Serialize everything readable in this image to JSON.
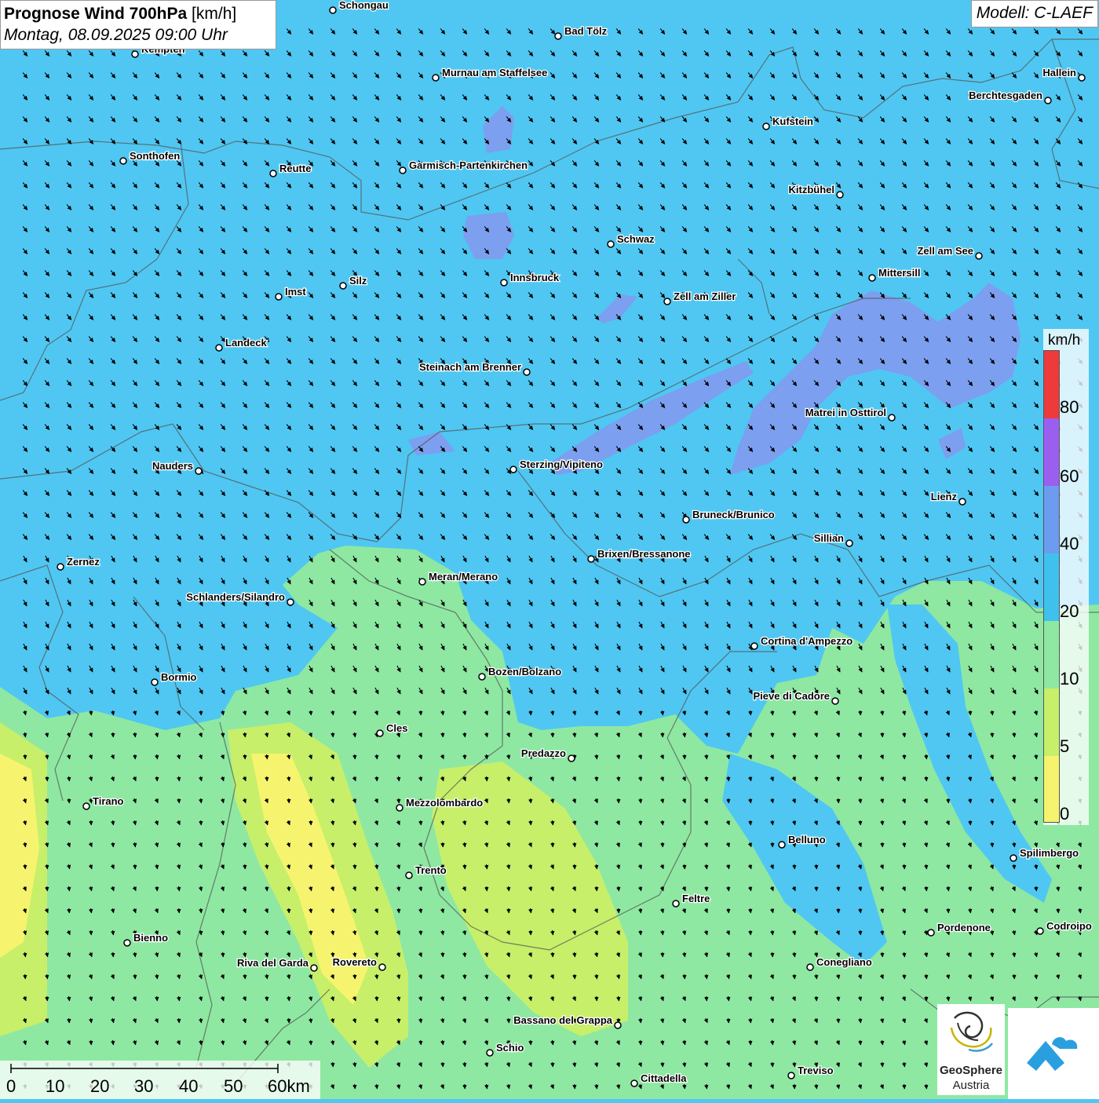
{
  "header": {
    "title_bold": "Prognose Wind 700hPa",
    "title_unit": "[km/h]",
    "subtitle": "Montag, 08.09.2025 09:00 Uhr",
    "model": "Modell: C-LAEF"
  },
  "legend": {
    "unit": "km/h",
    "ticks": [
      "80",
      "60",
      "40",
      "20",
      "10",
      "5",
      "0"
    ],
    "colors": {
      "over80": "#ee3a3a",
      "r60_80": "#9b5ff0",
      "r40_60": "#6b9cf0",
      "r20_40": "#3fc1ee",
      "r10_20": "#8ee8a2",
      "r5_10": "#c7ef6a",
      "r0_5": "#f6f46e"
    }
  },
  "scale_bar": {
    "labels": [
      "0",
      "10",
      "20",
      "30",
      "40",
      "50",
      "60km"
    ]
  },
  "logos": {
    "geosphere_line1": "GeoSphere",
    "geosphere_line2": "Austria",
    "geosphere_icon": "geosphere-swirl-icon",
    "app_icon": "cloud-mountain-icon"
  },
  "cities": [
    {
      "name": "Schongau",
      "side": "right"
    },
    {
      "name": "Bad Tölz",
      "side": "right"
    },
    {
      "name": "Kempten",
      "side": "right"
    },
    {
      "name": "Murnau am Staffelsee",
      "side": "right"
    },
    {
      "name": "Hallein",
      "side": "left"
    },
    {
      "name": "Berchtesgaden",
      "side": "left"
    },
    {
      "name": "Kufstein",
      "side": "right"
    },
    {
      "name": "Sonthofen",
      "side": "right"
    },
    {
      "name": "Reutte",
      "side": "right"
    },
    {
      "name": "Garmisch-Partenkirchen",
      "side": "right"
    },
    {
      "name": "Kitzbühel",
      "side": "left"
    },
    {
      "name": "Schwaz",
      "side": "right"
    },
    {
      "name": "Zell am See",
      "side": "left"
    },
    {
      "name": "Innsbruck",
      "side": "right"
    },
    {
      "name": "Mittersill",
      "side": "right"
    },
    {
      "name": "Silz",
      "side": "right"
    },
    {
      "name": "Imst",
      "side": "right"
    },
    {
      "name": "Zell am Ziller",
      "side": "right"
    },
    {
      "name": "Landeck",
      "side": "right"
    },
    {
      "name": "Steinach am Brenner",
      "side": "left"
    },
    {
      "name": "Matrei in Osttirol",
      "side": "left"
    },
    {
      "name": "Nauders",
      "side": "left"
    },
    {
      "name": "Sterzing/Vipiteno",
      "side": "right"
    },
    {
      "name": "Lienz",
      "side": "left"
    },
    {
      "name": "Bruneck/Brunico",
      "side": "right"
    },
    {
      "name": "Sillian",
      "side": "left"
    },
    {
      "name": "Brixen/Bressanone",
      "side": "right"
    },
    {
      "name": "Zernez",
      "side": "right"
    },
    {
      "name": "Meran/Merano",
      "side": "right"
    },
    {
      "name": "Schlanders/Silandro",
      "side": "left"
    },
    {
      "name": "Cortina d'Ampezzo",
      "side": "right"
    },
    {
      "name": "Bozen/Bolzano",
      "side": "right"
    },
    {
      "name": "Bormio",
      "side": "right"
    },
    {
      "name": "Pieve di Cadore",
      "side": "left"
    },
    {
      "name": "Cles",
      "side": "right"
    },
    {
      "name": "Predazzo",
      "side": "left"
    },
    {
      "name": "Tirano",
      "side": "right"
    },
    {
      "name": "Mezzolombardo",
      "side": "right"
    },
    {
      "name": "Belluno",
      "side": "right"
    },
    {
      "name": "Spilimbergo",
      "side": "right"
    },
    {
      "name": "Trento",
      "side": "right"
    },
    {
      "name": "Feltre",
      "side": "right"
    },
    {
      "name": "Pordenone",
      "side": "right"
    },
    {
      "name": "Codroipo",
      "side": "right"
    },
    {
      "name": "Bienno",
      "side": "right"
    },
    {
      "name": "Riva del Garda",
      "side": "left"
    },
    {
      "name": "Rovereto",
      "side": "left"
    },
    {
      "name": "Conegliano",
      "side": "right"
    },
    {
      "name": "Bassano del Grappa",
      "side": "left"
    },
    {
      "name": "Schio",
      "side": "right"
    },
    {
      "name": "Treviso",
      "side": "right"
    },
    {
      "name": "Cittadella",
      "side": "right"
    }
  ]
}
